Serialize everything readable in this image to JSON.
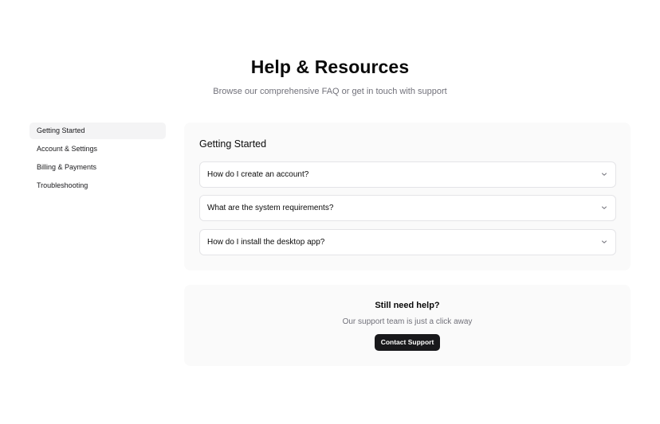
{
  "header": {
    "title": "Help & Resources",
    "subtitle": "Browse our comprehensive FAQ or get in touch with support"
  },
  "sidebar": {
    "active_index": 0,
    "items": [
      {
        "label": "Getting Started"
      },
      {
        "label": "Account & Settings"
      },
      {
        "label": "Billing & Payments"
      },
      {
        "label": "Troubleshooting"
      }
    ]
  },
  "faq": {
    "heading": "Getting Started",
    "items": [
      {
        "question": "How do I create an account?",
        "expanded": false,
        "icon": "chevron-down-icon"
      },
      {
        "question": "What are the system requirements?",
        "expanded": false,
        "icon": "chevron-down-icon"
      },
      {
        "question": "How do I install the desktop app?",
        "expanded": false,
        "icon": "chevron-down-icon"
      }
    ]
  },
  "support": {
    "title": "Still need help?",
    "subtitle": "Our support team is just a click away",
    "button_label": "Contact Support"
  },
  "colors": {
    "background": "#ffffff",
    "panel": "#fafafa",
    "active_item": "#f4f4f5",
    "border": "#e4e4e7",
    "muted_text": "#71717a",
    "button": "#18181b"
  }
}
